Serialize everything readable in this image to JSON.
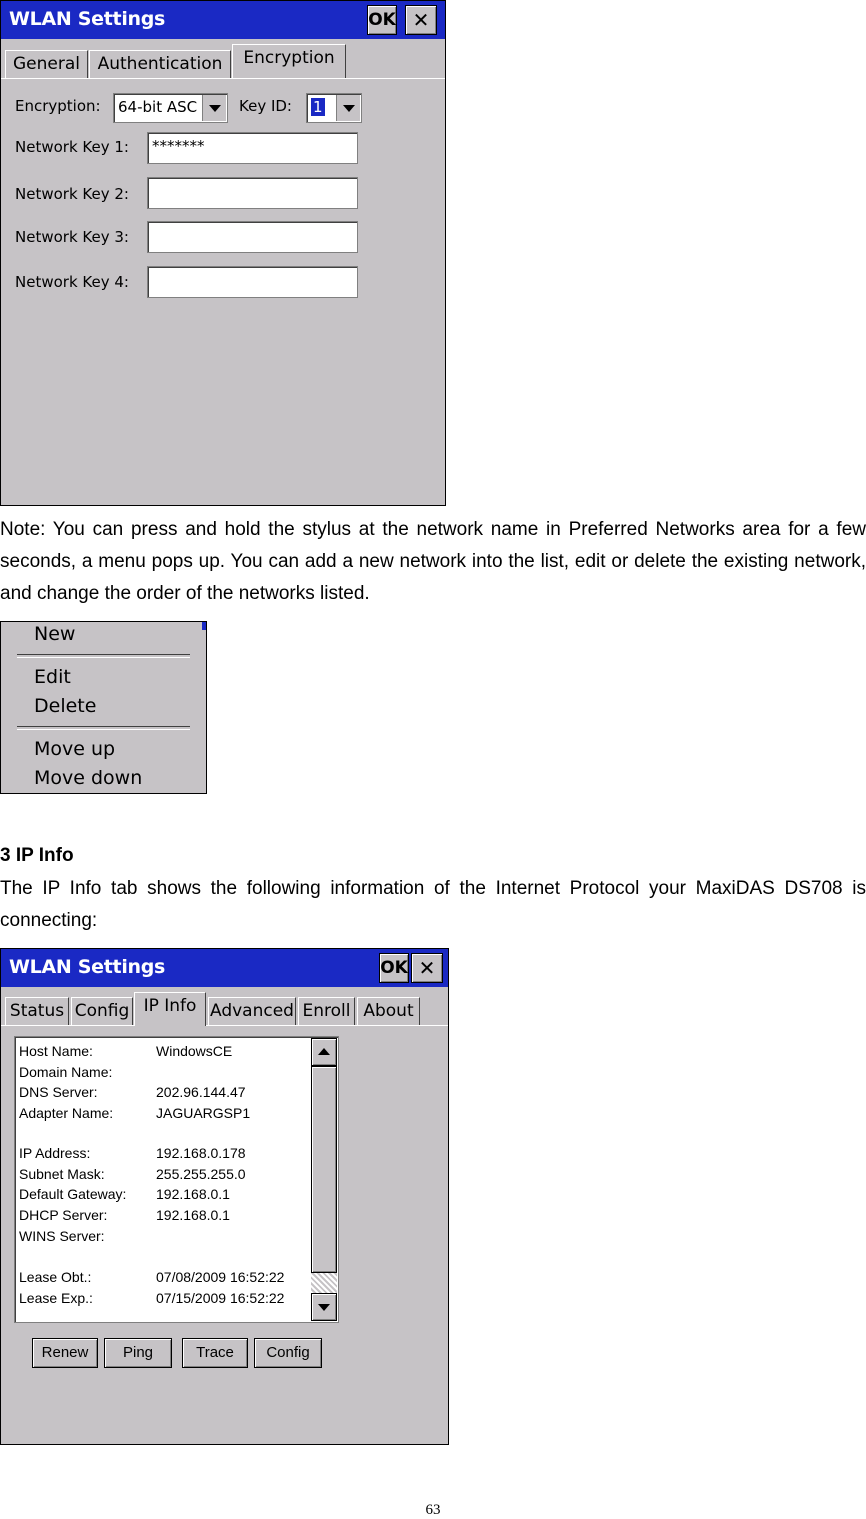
{
  "encryption_dialog": {
    "title": "WLAN Settings",
    "ok_label": "OK",
    "close_label": "✕",
    "tabs": [
      {
        "label": "General"
      },
      {
        "label": "Authentication"
      },
      {
        "label": "Encryption"
      }
    ],
    "encryption_label": "Encryption:",
    "encryption_value": "64-bit ASC",
    "keyid_label": "Key ID:",
    "keyid_value": "1",
    "keys": [
      {
        "label": "Network Key 1:",
        "value": "*******"
      },
      {
        "label": "Network Key 2:",
        "value": ""
      },
      {
        "label": "Network Key 3:",
        "value": ""
      },
      {
        "label": "Network Key 4:",
        "value": ""
      }
    ]
  },
  "note_text": "Note: You can press and hold the stylus at the network name in Preferred Networks area for a few seconds, a menu pops up. You can add a new network into the list, edit or delete the existing network, and change the order of the networks listed.",
  "context_menu": {
    "new": "New",
    "edit": "Edit",
    "delete": "Delete",
    "move_up": "Move up",
    "move_down": "Move down"
  },
  "section": {
    "heading": "3 IP Info",
    "body": "The IP Info tab shows the following information of the Internet Protocol your MaxiDAS DS708 is connecting:"
  },
  "ipinfo_dialog": {
    "title": "WLAN Settings",
    "ok_label": "OK",
    "close_label": "✕",
    "tabs": [
      {
        "label": "Status"
      },
      {
        "label": "Config"
      },
      {
        "label": "IP Info"
      },
      {
        "label": "Advanced"
      },
      {
        "label": "Enroll"
      },
      {
        "label": "About"
      }
    ],
    "rows": [
      {
        "key": "Host Name:",
        "value": "WindowsCE"
      },
      {
        "key": "Domain Name:",
        "value": ""
      },
      {
        "key": "DNS Server:",
        "value": "202.96.144.47"
      },
      {
        "key": "Adapter Name:",
        "value": "JAGUARGSP1"
      },
      {
        "key": "IP Address:",
        "value": "192.168.0.178"
      },
      {
        "key": "Subnet Mask:",
        "value": "255.255.255.0"
      },
      {
        "key": "Default Gateway:",
        "value": "192.168.0.1"
      },
      {
        "key": "DHCP Server:",
        "value": "192.168.0.1"
      },
      {
        "key": "WINS Server:",
        "value": ""
      },
      {
        "key": "Lease Obt.:",
        "value": "07/08/2009 16:52:22"
      },
      {
        "key": "Lease Exp.:",
        "value": "07/15/2009 16:52:22"
      }
    ],
    "buttons": [
      {
        "label": "Renew"
      },
      {
        "label": "Ping"
      },
      {
        "label": "Trace"
      },
      {
        "label": "Config"
      }
    ]
  },
  "page_number": "63"
}
